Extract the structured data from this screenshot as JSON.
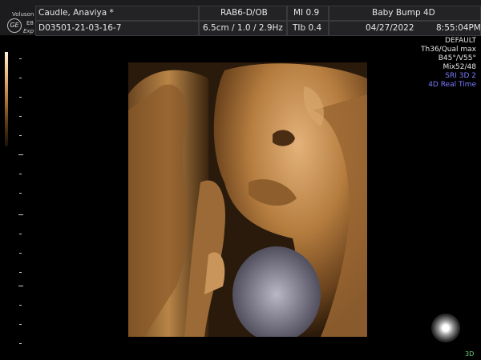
{
  "header": {
    "brand": "Voluson",
    "model": "E8",
    "mode": "Exp",
    "logo": "GE",
    "patient_name": "Caudle, Anaviya  *",
    "probe": "RAB6-D/OB",
    "mi": "MI  0.9",
    "preset": "Baby Bump 4D",
    "patient_id": "D03501-21-03-16-7",
    "depth_freq": "6.5cm / 1.0 / 2.9Hz",
    "tib": "TIb  0.4",
    "date": "04/27/2022",
    "time": "8:55:04PM"
  },
  "settings": {
    "line1": "DEFAULT",
    "line2": "Th36/Qual max",
    "line3": "B45°/V55°",
    "line4": "Mix52/48",
    "line5": "SRI 3D 2",
    "line6": "4D Real Time"
  },
  "colors": {
    "header_bg": "#1c1c1e",
    "settings_white": "#e6e6e6",
    "settings_blue": "#7a7cff",
    "indicator_green": "#6fd07a"
  },
  "icons": {
    "probe_orientation": "probe-orientation-icon",
    "grayscale_bar": "color-scale-bar"
  },
  "footer": {
    "mode_indicator": "3D"
  }
}
